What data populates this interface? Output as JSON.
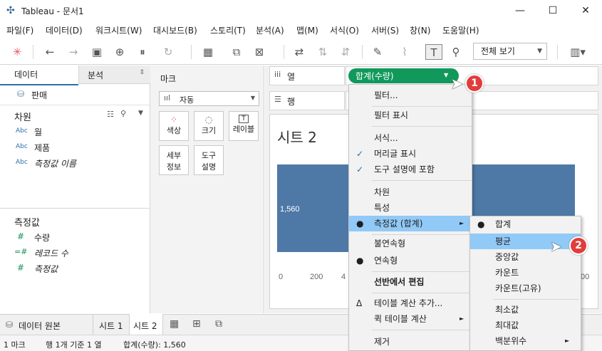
{
  "window": {
    "title": "Tableau - 문서1",
    "minimize": "—",
    "maximize": "☐",
    "close": "✕",
    "icon": "tableau-logo-icon"
  },
  "menubar": [
    "파일(F)",
    "데이터(D)",
    "워크시트(W)",
    "대시보드(B)",
    "스토리(T)",
    "분석(A)",
    "맵(M)",
    "서식(O)",
    "서버(S)",
    "창(N)",
    "도움말(H)"
  ],
  "toolbar": {
    "view_select": "전체 보기",
    "icons": [
      "tableau-icon",
      "back-icon",
      "forward-icon",
      "save-icon",
      "add-datasource-icon",
      "pause-icon",
      "refresh-icon",
      "new-worksheet-icon",
      "duplicate-icon",
      "clear-icon",
      "swap-icon",
      "sort-asc-icon",
      "sort-desc-icon",
      "highlight-icon",
      "annotate-icon",
      "label-icon",
      "pin-icon",
      "show-me-icon"
    ]
  },
  "left": {
    "tab_data": "데이터",
    "tab_analysis": "분석",
    "datasource": "판매",
    "dimensions_header": "차원",
    "dimensions": [
      {
        "type": "Abc",
        "name": "월"
      },
      {
        "type": "Abc",
        "name": "제품"
      },
      {
        "type": "Abc",
        "name": "측정값 이름"
      }
    ],
    "measures_header": "측정값",
    "measures": [
      {
        "type": "#",
        "name": "수량"
      },
      {
        "type": "=#",
        "name": "레코드 수"
      },
      {
        "type": "#",
        "name": "측정값"
      }
    ]
  },
  "marks": {
    "header": "마크",
    "type": "자동",
    "buttons": [
      "색상",
      "크기",
      "레이블"
    ],
    "buttons2": [
      [
        "세부",
        "정보"
      ],
      [
        "도구",
        "설명"
      ]
    ]
  },
  "shelves": {
    "columns_label": "열",
    "rows_label": "행",
    "pill": "합계(수량)"
  },
  "sheet": {
    "title": "시트 2",
    "bar_label": "1,560",
    "axis_ticks": [
      "0",
      "200",
      "4",
      "00"
    ]
  },
  "chart_data": {
    "type": "bar",
    "categories": [
      ""
    ],
    "values": [
      1560
    ],
    "xlim": [
      0,
      1600
    ],
    "orientation": "horizontal"
  },
  "context_menu": {
    "items": [
      {
        "label": "필터...",
        "check": ""
      },
      {
        "label": "필터 표시",
        "check": ""
      },
      {
        "label": "서식...",
        "check": ""
      },
      {
        "label": "머리글 표시",
        "check": "✓"
      },
      {
        "label": "도구 설명에 포함",
        "check": "✓"
      },
      {
        "label": "차원",
        "check": ""
      },
      {
        "label": "특성",
        "check": ""
      },
      {
        "label": "측정값 (합계)",
        "check": "●",
        "submenu": "►"
      },
      {
        "label": "불연속형",
        "check": ""
      },
      {
        "label": "연속형",
        "check": "●"
      },
      {
        "label": "선반에서 편집",
        "check": ""
      },
      {
        "label": "테이블 계산 추가...",
        "check": "Δ"
      },
      {
        "label": "퀵 테이블 계산",
        "check": "",
        "submenu": "►"
      },
      {
        "label": "제거",
        "check": ""
      }
    ]
  },
  "submenu": {
    "items": [
      {
        "label": "합계",
        "check": "●"
      },
      {
        "label": "평균",
        "check": ""
      },
      {
        "label": "중앙값",
        "check": ""
      },
      {
        "label": "카운트",
        "check": ""
      },
      {
        "label": "카운트(고유)",
        "check": ""
      },
      {
        "label": "최소값",
        "check": ""
      },
      {
        "label": "최대값",
        "check": ""
      },
      {
        "label": "백분위수",
        "check": "",
        "submenu": "►"
      }
    ]
  },
  "callouts": [
    "1",
    "2"
  ],
  "bottom_tabs": {
    "datasource": "데이터 원본",
    "sheet1": "시트 1",
    "sheet2": "시트 2"
  },
  "status": {
    "marks": "1 마크",
    "rows": "행 1개 기준 1 열",
    "sum": "합계(수량): 1,560"
  },
  "colors": {
    "pill": "#11995b",
    "bar": "#4e79a7",
    "highlight": "#91c9f7",
    "callout": "#e23c3c"
  }
}
